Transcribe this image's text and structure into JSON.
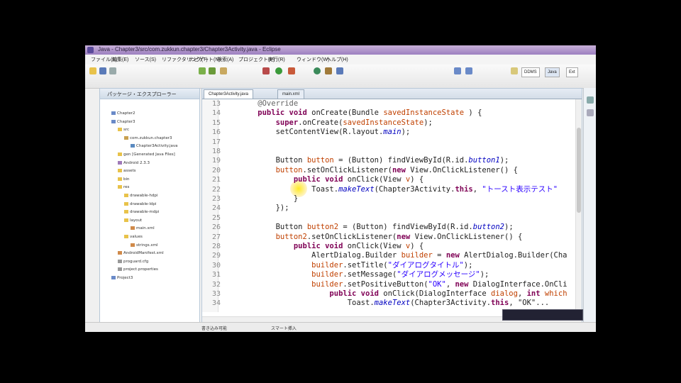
{
  "window": {
    "title": "Java - Chapter3/src/com.zukkun.chapter3/Chapter3Activity.java - Eclipse"
  },
  "menu": [
    "ファイル(F)",
    "編集(E)",
    "ソース(S)",
    "リファクタリング(T)",
    "ナビゲート(N)",
    "検索(A)",
    "プロジェクト(P)",
    "実行(R)",
    "ウィンドウ(W)",
    "ヘルプ(H)"
  ],
  "perspectives": [
    "DDMS",
    "Java",
    "Ext"
  ],
  "package_explorer": {
    "tab_label": "パッケージ・エクスプローラー",
    "items": [
      {
        "label": "Chapter2",
        "depth": 0,
        "icon": "project"
      },
      {
        "label": "Chapter3",
        "depth": 0,
        "icon": "project"
      },
      {
        "label": "src",
        "depth": 1,
        "icon": "folder"
      },
      {
        "label": "com.zukkun.chapter3",
        "depth": 2,
        "icon": "package"
      },
      {
        "label": "Chapter3Activity.java",
        "depth": 3,
        "icon": "java-file"
      },
      {
        "label": "gen [Generated Java Files]",
        "depth": 1,
        "icon": "folder"
      },
      {
        "label": "Android 2.3.3",
        "depth": 1,
        "icon": "library"
      },
      {
        "label": "assets",
        "depth": 1,
        "icon": "folder"
      },
      {
        "label": "bin",
        "depth": 1,
        "icon": "folder"
      },
      {
        "label": "res",
        "depth": 1,
        "icon": "folder"
      },
      {
        "label": "drawable-hdpi",
        "depth": 2,
        "icon": "folder"
      },
      {
        "label": "drawable-ldpi",
        "depth": 2,
        "icon": "folder"
      },
      {
        "label": "drawable-mdpi",
        "depth": 2,
        "icon": "folder"
      },
      {
        "label": "layout",
        "depth": 2,
        "icon": "folder"
      },
      {
        "label": "main.xml",
        "depth": 3,
        "icon": "xml-file"
      },
      {
        "label": "values",
        "depth": 2,
        "icon": "folder"
      },
      {
        "label": "strings.xml",
        "depth": 3,
        "icon": "xml-file"
      },
      {
        "label": "AndroidManifest.xml",
        "depth": 1,
        "icon": "xml-file"
      },
      {
        "label": "proguard.cfg",
        "depth": 1,
        "icon": "file"
      },
      {
        "label": "project.properties",
        "depth": 1,
        "icon": "file"
      },
      {
        "label": "Project3",
        "depth": 0,
        "icon": "project"
      }
    ]
  },
  "editor": {
    "tabs": [
      {
        "label": "Chapter3Activity.java",
        "active": true
      },
      {
        "label": "main.xml",
        "active": false
      }
    ],
    "lines": [
      {
        "no": "13",
        "parts": [
          [
            "ann",
            "    @Override"
          ]
        ]
      },
      {
        "no": "14",
        "parts": [
          [
            "kw",
            "    public void "
          ],
          [
            "",
            "onCreate(Bundle "
          ],
          [
            "var",
            "savedInstanceState"
          ],
          [
            "",
            " ) {"
          ]
        ]
      },
      {
        "no": "15",
        "parts": [
          [
            "kw",
            "        super"
          ],
          [
            "",
            ".onCreate("
          ],
          [
            "var",
            "savedInstanceState"
          ],
          [
            "",
            ");"
          ]
        ]
      },
      {
        "no": "16",
        "parts": [
          [
            "",
            "        setContentView(R.layout."
          ],
          [
            "fld",
            "main"
          ],
          [
            "",
            ");"
          ]
        ]
      },
      {
        "no": "17",
        "parts": [
          [
            "",
            ""
          ]
        ]
      },
      {
        "no": "18",
        "parts": [
          [
            "",
            ""
          ]
        ]
      },
      {
        "no": "19",
        "parts": [
          [
            "",
            "        Button "
          ],
          [
            "var",
            "button"
          ],
          [
            "",
            " = (Button) findViewById(R.id."
          ],
          [
            "fld",
            "button1"
          ],
          [
            "",
            ");"
          ]
        ]
      },
      {
        "no": "20",
        "parts": [
          [
            "var",
            "        button"
          ],
          [
            "",
            ".setOnClickListener("
          ],
          [
            "kw",
            "new "
          ],
          [
            "",
            "View.OnClickListener() {"
          ]
        ]
      },
      {
        "no": "21",
        "parts": [
          [
            "kw",
            "            public void "
          ],
          [
            "",
            "onClick(View "
          ],
          [
            "var",
            "v"
          ],
          [
            "",
            ") {"
          ]
        ]
      },
      {
        "no": "22",
        "parts": [
          [
            "",
            "                Toast."
          ],
          [
            "fld",
            "makeText"
          ],
          [
            "",
            "(Chapter3Activity."
          ],
          [
            "kw",
            "this"
          ],
          [
            "",
            ", "
          ],
          [
            "str",
            "\"トースト表示テスト\""
          ]
        ]
      },
      {
        "no": "23",
        "parts": [
          [
            "",
            "            }"
          ]
        ]
      },
      {
        "no": "24",
        "parts": [
          [
            "",
            "        });"
          ]
        ]
      },
      {
        "no": "25",
        "parts": [
          [
            "",
            ""
          ]
        ]
      },
      {
        "no": "26",
        "parts": [
          [
            "",
            "        Button "
          ],
          [
            "var",
            "button2"
          ],
          [
            "",
            " = (Button) findViewById(R.id."
          ],
          [
            "fld",
            "button2"
          ],
          [
            "",
            ");"
          ]
        ]
      },
      {
        "no": "27",
        "parts": [
          [
            "var",
            "        button2"
          ],
          [
            "",
            ".setOnClickListener("
          ],
          [
            "kw",
            "new "
          ],
          [
            "",
            "View.OnClickListener() {"
          ]
        ]
      },
      {
        "no": "28",
        "parts": [
          [
            "kw",
            "            public void "
          ],
          [
            "",
            "onClick(View "
          ],
          [
            "var",
            "v"
          ],
          [
            "",
            ") {"
          ]
        ]
      },
      {
        "no": "29",
        "parts": [
          [
            "",
            "                AlertDialog.Builder "
          ],
          [
            "var",
            "builder"
          ],
          [
            "",
            " = "
          ],
          [
            "kw",
            "new "
          ],
          [
            "",
            "AlertDialog.Builder(Cha"
          ]
        ]
      },
      {
        "no": "30",
        "parts": [
          [
            "var",
            "                builder"
          ],
          [
            "",
            ".setTitle("
          ],
          [
            "str",
            "\"ダイアログタイトル\""
          ],
          [
            "",
            ");"
          ]
        ]
      },
      {
        "no": "31",
        "parts": [
          [
            "var",
            "                builder"
          ],
          [
            "",
            ".setMessage("
          ],
          [
            "str",
            "\"ダイアログメッセージ\""
          ],
          [
            "",
            ");"
          ]
        ]
      },
      {
        "no": "32",
        "parts": [
          [
            "var",
            "                builder"
          ],
          [
            "",
            ".setPositiveButton("
          ],
          [
            "str",
            "\"OK\""
          ],
          [
            "",
            ", "
          ],
          [
            "kw",
            "new "
          ],
          [
            "",
            "DialogInterface.OnCli"
          ]
        ]
      },
      {
        "no": "33",
        "parts": [
          [
            "kw",
            "                    public void "
          ],
          [
            "",
            "onClick(DialogInterface "
          ],
          [
            "var",
            "dialog"
          ],
          [
            "",
            ", "
          ],
          [
            "kw",
            "int "
          ],
          [
            "var",
            "which"
          ]
        ]
      },
      {
        "no": "34",
        "parts": [
          [
            "",
            "                        Toast."
          ],
          [
            "fld",
            "makeText"
          ],
          [
            "",
            "(Chapter3Activity."
          ],
          [
            "kw",
            "this"
          ],
          [
            "",
            ", \"OK\"..."
          ]
        ]
      }
    ]
  },
  "status": {
    "mode": "書き込み可能",
    "insert": "スマート挿入"
  }
}
